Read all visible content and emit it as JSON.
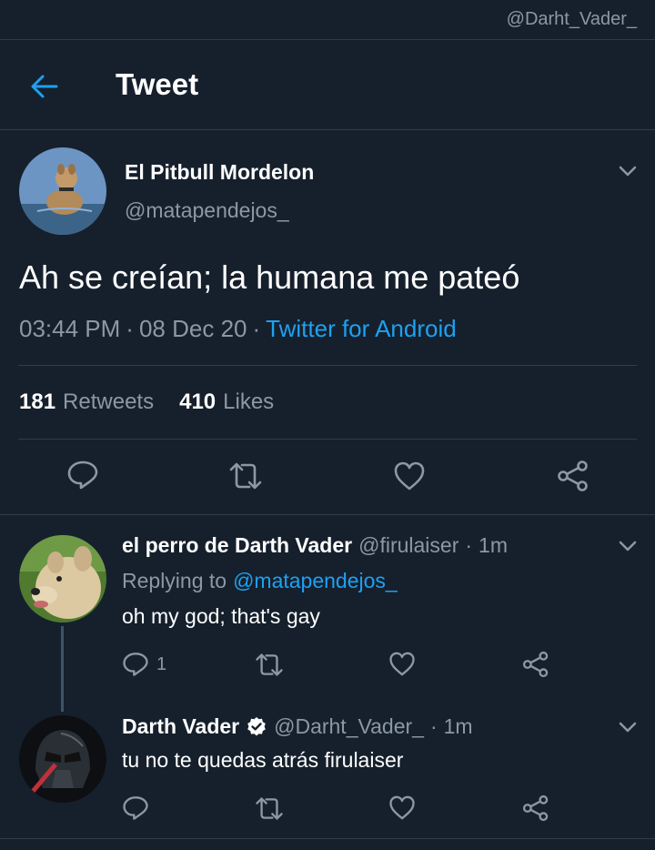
{
  "watermark": "@Darht_Vader_",
  "header": {
    "title": "Tweet"
  },
  "tweet": {
    "author_name": "El Pitbull Mordelon",
    "author_handle": "@matapendejos_",
    "text": "Ah se creían; la humana me pateó",
    "time": "03:44 PM",
    "sep1": "·",
    "date": "08 Dec 20",
    "sep2": "·",
    "source": "Twitter for Android",
    "retweets_count": "181",
    "retweets_label": "Retweets",
    "likes_count": "410",
    "likes_label": "Likes"
  },
  "replies": [
    {
      "name": "el perro de Darth Vader",
      "handle": "@firulaiser",
      "sep": "·",
      "time": "1m",
      "replying_prefix": "Replying to",
      "replying_to": "@matapendejos_",
      "text": "oh my god; that's gay",
      "reply_count": "1"
    },
    {
      "name": "Darth Vader",
      "verified": true,
      "handle": "@Darht_Vader_",
      "sep": "·",
      "time": "1m",
      "text": "tu no te quedas atrás firulaiser",
      "reply_count": ""
    }
  ],
  "colors": {
    "background": "#16202c",
    "accent": "#1da1f2",
    "muted": "#8b98a5",
    "divider": "#2f3c4a"
  },
  "icons": [
    "back-arrow-icon",
    "chevron-down-icon",
    "reply-icon",
    "retweet-icon",
    "like-icon",
    "share-icon",
    "verified-badge-icon"
  ]
}
